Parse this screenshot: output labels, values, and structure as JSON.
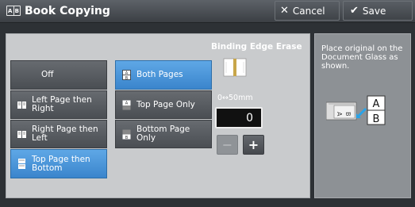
{
  "header": {
    "title": "Book Copying",
    "cancel_label": "Cancel",
    "save_label": "Save"
  },
  "binding_options": [
    {
      "label": "Off",
      "selected": false,
      "icon": "none"
    },
    {
      "label": "Left Page then Right",
      "selected": false,
      "icon": "open-book-icon"
    },
    {
      "label": "Right Page then Left",
      "selected": false,
      "icon": "open-book-icon"
    },
    {
      "label": "Top Page then Bottom",
      "selected": true,
      "icon": "stacked-pages-icon"
    }
  ],
  "page_options": [
    {
      "label": "Both Pages",
      "selected": true,
      "icon": "both-pages-icon"
    },
    {
      "label": "Top Page Only",
      "selected": false,
      "icon": "top-page-icon"
    },
    {
      "label": "Bottom Page Only",
      "selected": false,
      "icon": "bottom-page-icon"
    }
  ],
  "binding_edge_erase": {
    "title": "Binding Edge Erase",
    "range": "0↔50mm",
    "value": "0"
  },
  "instructions": {
    "text": "Place original on the Document Glass as shown.",
    "diagram_labels": [
      "A",
      "B"
    ]
  },
  "colors": {
    "selected": "#3a85cc",
    "button": "#4a4e53",
    "panel": "#c9cbcd",
    "arrow": "#29a3e8"
  }
}
